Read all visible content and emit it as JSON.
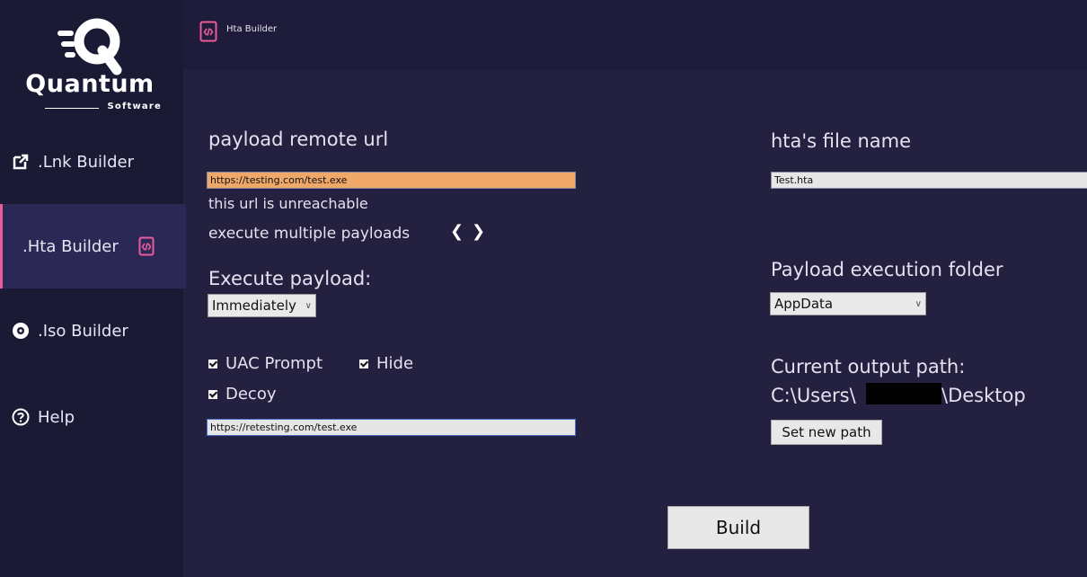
{
  "app": {
    "logo_word": "Quantum",
    "logo_sub": "Software",
    "accent_color": "#e85c9a"
  },
  "topbar": {
    "title": "Hta Builder",
    "icon": "html-file-icon"
  },
  "sidebar": {
    "items": [
      {
        "label": ".Lnk Builder",
        "icon": "external-link-icon",
        "active": false
      },
      {
        "label": ".Hta Builder",
        "icon": "html-file-icon",
        "active": true
      },
      {
        "label": ".Iso Builder",
        "icon": "disc-icon",
        "active": false
      },
      {
        "label": "Help",
        "icon": "help-circle-icon",
        "active": false
      }
    ]
  },
  "main": {
    "payload_url_label": "payload remote url",
    "payload_url_value": "https://testing.com/test.exe",
    "url_status": "this url is unreachable",
    "multiple_payloads_label": "execute multiple payloads",
    "execute_payload_label": "Execute payload:",
    "execute_payload_selected": "Immediately",
    "uac_prompt_label": "UAC Prompt",
    "uac_prompt_checked": true,
    "hide_label": "Hide",
    "hide_checked": true,
    "decoy_label": "Decoy",
    "decoy_checked": true,
    "decoy_url_value": "https://retesting.com/test.exe",
    "hta_file_name_label": "hta's file name",
    "hta_file_name_value": "Test.hta",
    "exec_folder_label": "Payload execution folder",
    "exec_folder_selected": "AppData",
    "output_path_label": "Current output path:",
    "output_path_prefix": "C:\\Users\\",
    "output_path_suffix": "\\Desktop",
    "set_path_button": "Set new path",
    "build_button": "Build"
  }
}
